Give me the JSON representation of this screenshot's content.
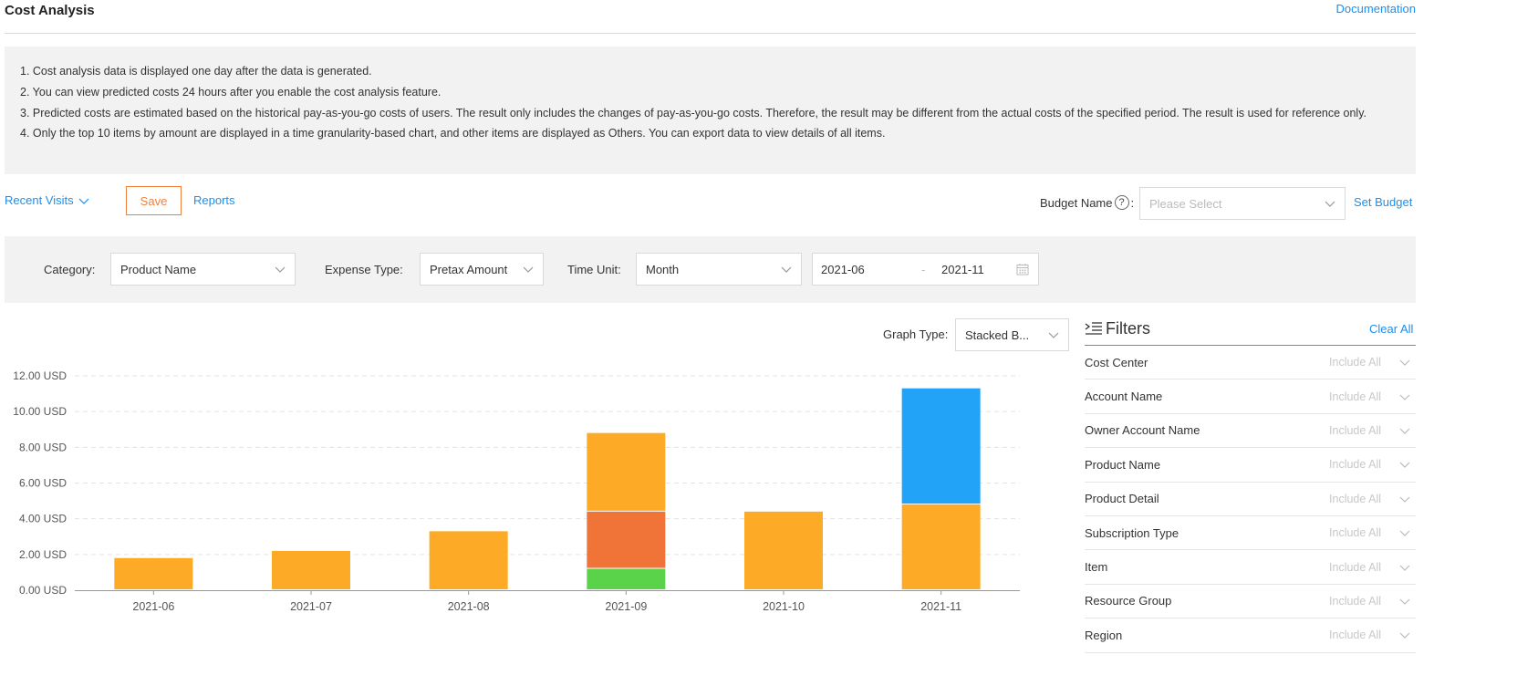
{
  "header": {
    "title": "Cost Analysis",
    "documentation_link": "Documentation"
  },
  "notice": {
    "lines": [
      "1. Cost analysis data is displayed one day after the data is generated.",
      "2. You can view predicted costs 24 hours after you enable the cost analysis feature.",
      "3. Predicted costs are estimated based on the historical pay-as-you-go costs of users. The result only includes the changes of pay-as-you-go costs. Therefore, the result may be different from the actual costs of the specified period. The result is used for reference only.",
      "4. Only the top 10 items by amount are displayed in a time granularity-based chart, and other items are displayed as Others. You can export data to view details of all items."
    ]
  },
  "toolbar": {
    "recent_visits": "Recent Visits",
    "save": "Save",
    "reports": "Reports"
  },
  "budget": {
    "label": "Budget Name",
    "help_icon_glyph": "?",
    "placeholder": "Please Select",
    "set_budget": "Set Budget"
  },
  "query": {
    "category_label": "Category:",
    "category_value": "Product Name",
    "expense_label": "Expense Type:",
    "expense_value": "Pretax Amount",
    "time_unit_label": "Time Unit:",
    "time_unit_value": "Month",
    "date_start": "2021-06",
    "date_separator": "-",
    "date_end": "2021-11",
    "calendar_icon": "calendar-icon"
  },
  "graph_type": {
    "label": "Graph Type:",
    "value": "Stacked B..."
  },
  "filters": {
    "title": "Filters",
    "clear_all": "Clear All",
    "rows": [
      {
        "name": "Cost Center",
        "value": "Include All"
      },
      {
        "name": "Account Name",
        "value": "Include All"
      },
      {
        "name": "Owner Account Name",
        "value": "Include All"
      },
      {
        "name": "Product Name",
        "value": "Include All"
      },
      {
        "name": "Product Detail",
        "value": "Include All"
      },
      {
        "name": "Subscription Type",
        "value": "Include All"
      },
      {
        "name": "Item",
        "value": "Include All"
      },
      {
        "name": "Resource Group",
        "value": "Include All"
      },
      {
        "name": "Region",
        "value": "Include All"
      }
    ]
  },
  "colors": {
    "accent": "#1a8ff0",
    "save": "#f07f3c"
  },
  "chart_data": {
    "type": "bar",
    "stacked": true,
    "categories": [
      "2021-06",
      "2021-07",
      "2021-08",
      "2021-09",
      "2021-10",
      "2021-11"
    ],
    "y_tick_labels": [
      "12.00 USD",
      "10.00 USD",
      "8.00 USD",
      "6.00 USD",
      "4.00 USD",
      "2.00 USD",
      "0.00 USD"
    ],
    "ylim": [
      0,
      12
    ],
    "grid": true,
    "series": [
      {
        "color": "#5ad34a",
        "values": [
          0,
          0,
          0,
          1.2,
          0,
          0
        ]
      },
      {
        "color": "#f07337",
        "values": [
          0,
          0,
          0,
          3.2,
          0,
          0
        ]
      },
      {
        "color": "#fdab27",
        "values": [
          1.8,
          2.2,
          3.3,
          4.4,
          4.4,
          4.8
        ]
      },
      {
        "color": "#22a3f8",
        "values": [
          0,
          0,
          0,
          0,
          0,
          6.5
        ]
      }
    ]
  }
}
